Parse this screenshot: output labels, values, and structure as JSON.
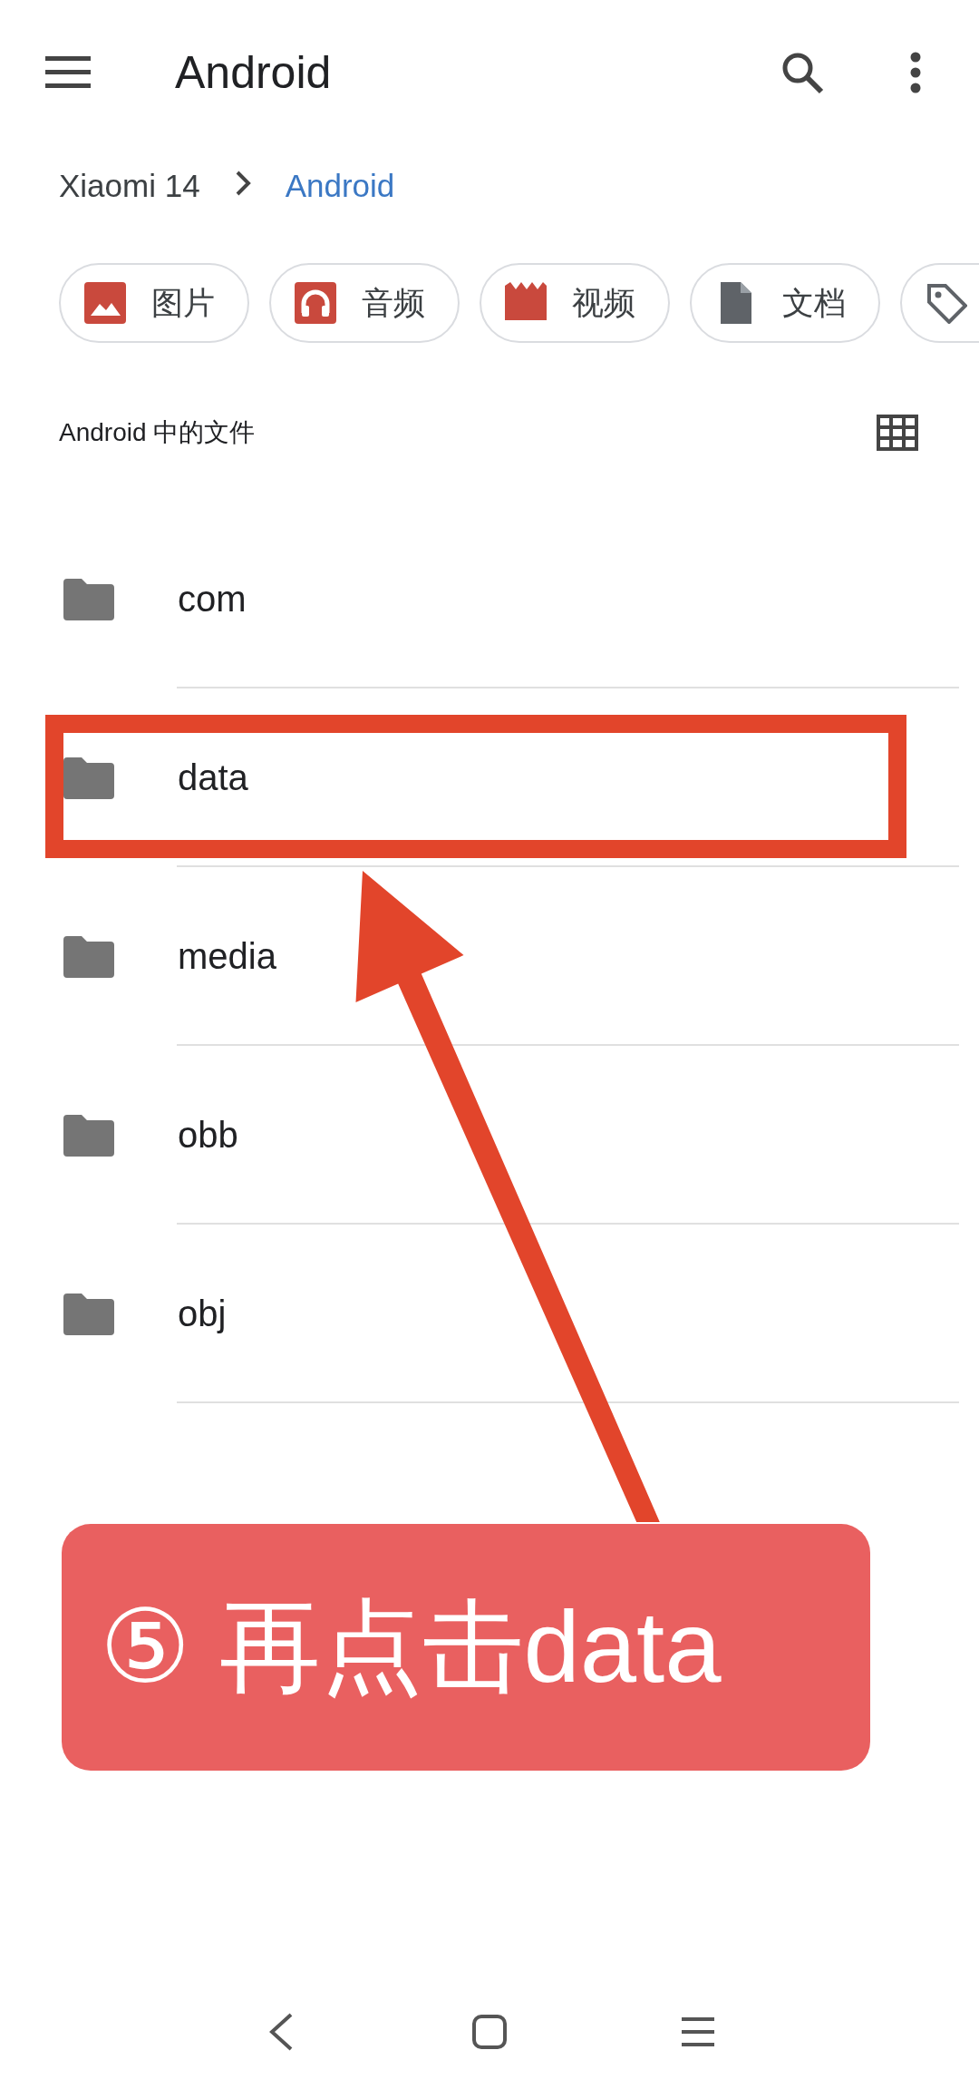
{
  "app_bar": {
    "title": "Android"
  },
  "breadcrumb": [
    {
      "label": "Xiaomi 14",
      "selected": false
    },
    {
      "label": "Android",
      "selected": true
    }
  ],
  "chips": [
    {
      "kind": "image",
      "label": "图片"
    },
    {
      "kind": "audio",
      "label": "音频"
    },
    {
      "kind": "video",
      "label": "视频"
    },
    {
      "kind": "document",
      "label": "文档"
    },
    {
      "kind": "tag"
    }
  ],
  "section": {
    "title": "Android 中的文件"
  },
  "files": [
    {
      "name": "com",
      "highlighted": false
    },
    {
      "name": "data",
      "highlighted": true
    },
    {
      "name": "media",
      "highlighted": false
    },
    {
      "name": "obb",
      "highlighted": false
    },
    {
      "name": "obj",
      "highlighted": false
    }
  ],
  "annotation": {
    "caption": "⑤ 再点击data"
  }
}
